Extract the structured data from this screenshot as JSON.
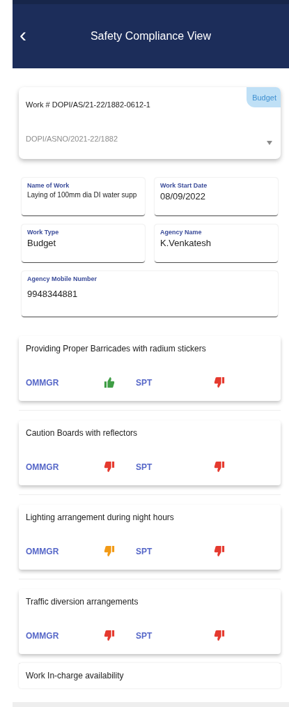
{
  "header": {
    "back": "‹",
    "title": "Safety Compliance View"
  },
  "work_card": {
    "work_no": "Work # DOPI/AS/21-22/1882-0612-1",
    "badge": "Budget",
    "placeholder": "DOPI/ASNO/2021-22/1882"
  },
  "fields": [
    {
      "label": "Name of Work",
      "value": "Laying of 100mm dia DI water supp"
    },
    {
      "label": "Work Start Date",
      "value": "08/09/2022"
    },
    {
      "label": "Work Type",
      "value": "Budget"
    },
    {
      "label": "Agency Name",
      "value": "K.Venkatesh"
    },
    {
      "label": "Agency Mobile Number",
      "value": "9948344881"
    }
  ],
  "checks": [
    {
      "title": "Providing Proper Barricades with radium stickers",
      "ratings": [
        {
          "role": "OMMGR",
          "kind": "up",
          "color": "#3f9e45"
        },
        {
          "role": "SPT",
          "kind": "down",
          "color": "#e53a2f"
        }
      ]
    },
    {
      "title": "Caution Boards with reflectors",
      "ratings": [
        {
          "role": "OMMGR",
          "kind": "down",
          "color": "#e53a2f"
        },
        {
          "role": "SPT",
          "kind": "down",
          "color": "#e53a2f"
        }
      ]
    },
    {
      "title": "Lighting arrangement during night hours",
      "ratings": [
        {
          "role": "OMMGR",
          "kind": "down",
          "color": "#f29a16"
        },
        {
          "role": "SPT",
          "kind": "down",
          "color": "#e53a2f"
        }
      ]
    },
    {
      "title": "Traffic diversion arrangements",
      "ratings": [
        {
          "role": "OMMGR",
          "kind": "down",
          "color": "#e53a2f"
        },
        {
          "role": "SPT",
          "kind": "down",
          "color": "#e53a2f"
        }
      ]
    },
    {
      "title": "Work In-charge availability"
    }
  ]
}
